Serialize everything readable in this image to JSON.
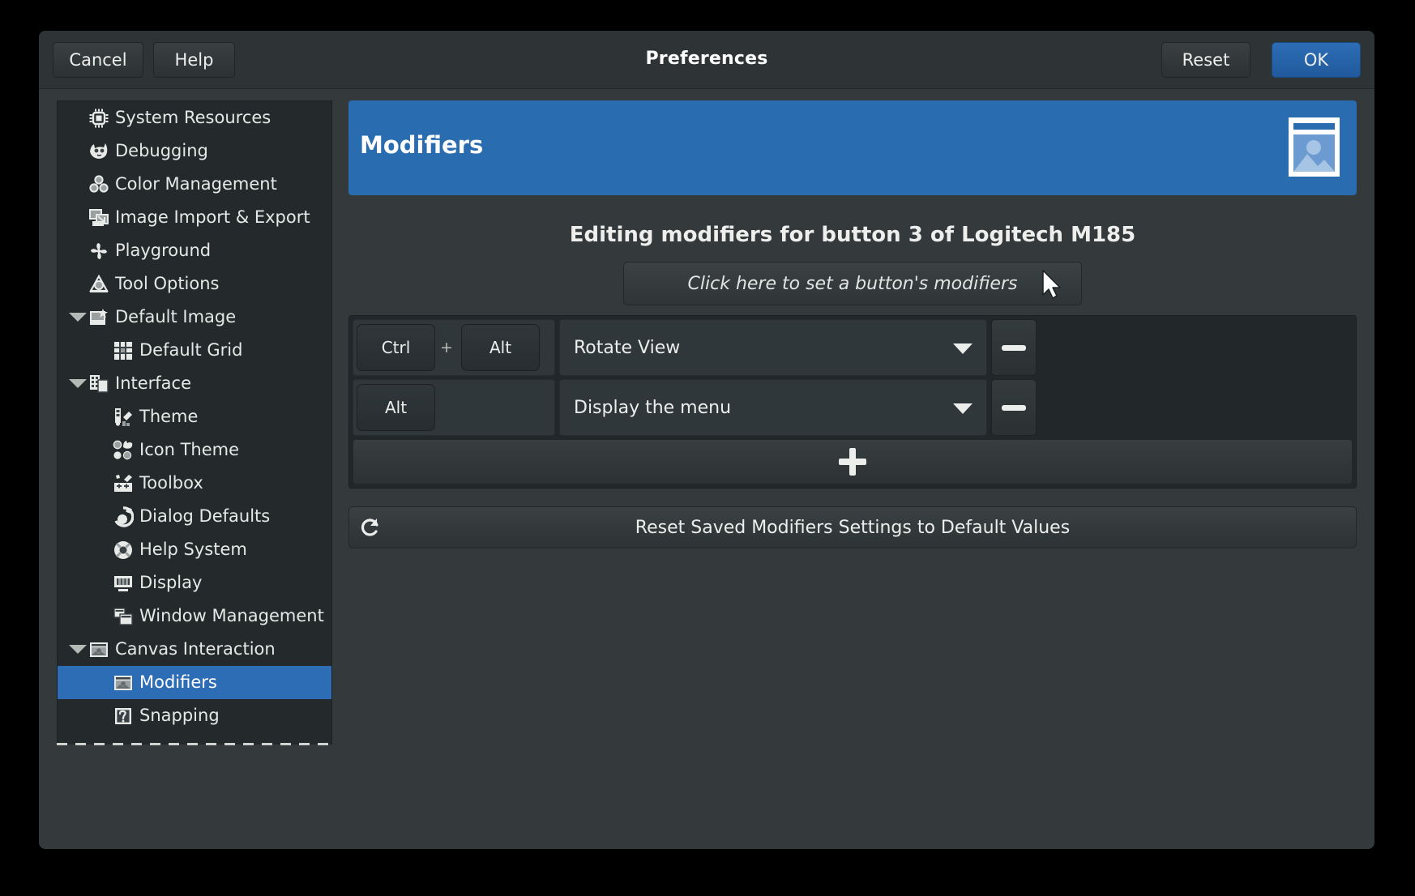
{
  "window": {
    "title": "Preferences",
    "cancel_label": "Cancel",
    "help_label": "Help",
    "reset_label": "Reset",
    "ok_label": "OK",
    "accent_color": "#2a6cb0",
    "background_color": "#343a3c"
  },
  "sidebar": {
    "items": [
      {
        "label": "System Resources",
        "icon": "cpu-chip-icon",
        "level": 0,
        "expander": "",
        "selected": false
      },
      {
        "label": "Debugging",
        "icon": "wilber-head-icon",
        "level": 0,
        "expander": "",
        "selected": false
      },
      {
        "label": "Color Management",
        "icon": "color-circles-icon",
        "level": 0,
        "expander": "",
        "selected": false
      },
      {
        "label": "Image Import & Export",
        "icon": "image-transfer-icon",
        "level": 0,
        "expander": "",
        "selected": false
      },
      {
        "label": "Playground",
        "icon": "pinwheel-icon",
        "level": 0,
        "expander": "",
        "selected": false
      },
      {
        "label": "Tool Options",
        "icon": "tool-options-icon",
        "level": 0,
        "expander": "",
        "selected": false
      },
      {
        "label": "Default Image",
        "icon": "new-image-icon",
        "level": 0,
        "expander": "down",
        "selected": false
      },
      {
        "label": "Default Grid",
        "icon": "grid-icon",
        "level": 1,
        "expander": "",
        "selected": false
      },
      {
        "label": "Interface",
        "icon": "interface-windows-icon",
        "level": 0,
        "expander": "down",
        "selected": false
      },
      {
        "label": "Theme",
        "icon": "theme-swatch-icon",
        "level": 1,
        "expander": "",
        "selected": false
      },
      {
        "label": "Icon Theme",
        "icon": "icon-theme-faces-icon",
        "level": 1,
        "expander": "",
        "selected": false
      },
      {
        "label": "Toolbox",
        "icon": "toolbox-icon",
        "level": 1,
        "expander": "",
        "selected": false
      },
      {
        "label": "Dialog Defaults",
        "icon": "dialog-defaults-icon",
        "level": 1,
        "expander": "",
        "selected": false
      },
      {
        "label": "Help System",
        "icon": "lifebuoy-icon",
        "level": 1,
        "expander": "",
        "selected": false
      },
      {
        "label": "Display",
        "icon": "monitor-icon",
        "level": 1,
        "expander": "",
        "selected": false
      },
      {
        "label": "Window Management",
        "icon": "stacked-windows-icon",
        "level": 1,
        "expander": "",
        "selected": false
      },
      {
        "label": "Canvas Interaction",
        "icon": "canvas-image-icon",
        "level": 0,
        "expander": "down",
        "selected": false
      },
      {
        "label": "Modifiers",
        "icon": "canvas-image-icon",
        "level": 1,
        "expander": "",
        "selected": true
      },
      {
        "label": "Snapping",
        "icon": "snapping-icon",
        "level": 1,
        "expander": "",
        "selected": false
      }
    ]
  },
  "page": {
    "banner_title": "Modifiers",
    "banner_icon": "image-placeholder-icon",
    "section_title": "Editing modifiers for button 3 of Logitech M185",
    "click_area": {
      "label": "Click here to set a button's modifiers",
      "icon": "mouse-pointer-icon"
    },
    "modifier_rows": [
      {
        "keys": [
          "Ctrl",
          "Alt"
        ],
        "separator": "+",
        "action": "Rotate View",
        "remove_icon": "minus-icon",
        "dropdown_icon": "chevron-down-icon"
      },
      {
        "keys": [
          "Alt"
        ],
        "separator": "",
        "action": "Display the menu",
        "remove_icon": "minus-icon",
        "dropdown_icon": "chevron-down-icon"
      }
    ],
    "add_row": {
      "icon": "plus-icon"
    },
    "reset_button": {
      "label": "Reset Saved Modifiers Settings to Default Values",
      "icon": "reset-arrow-icon"
    }
  }
}
